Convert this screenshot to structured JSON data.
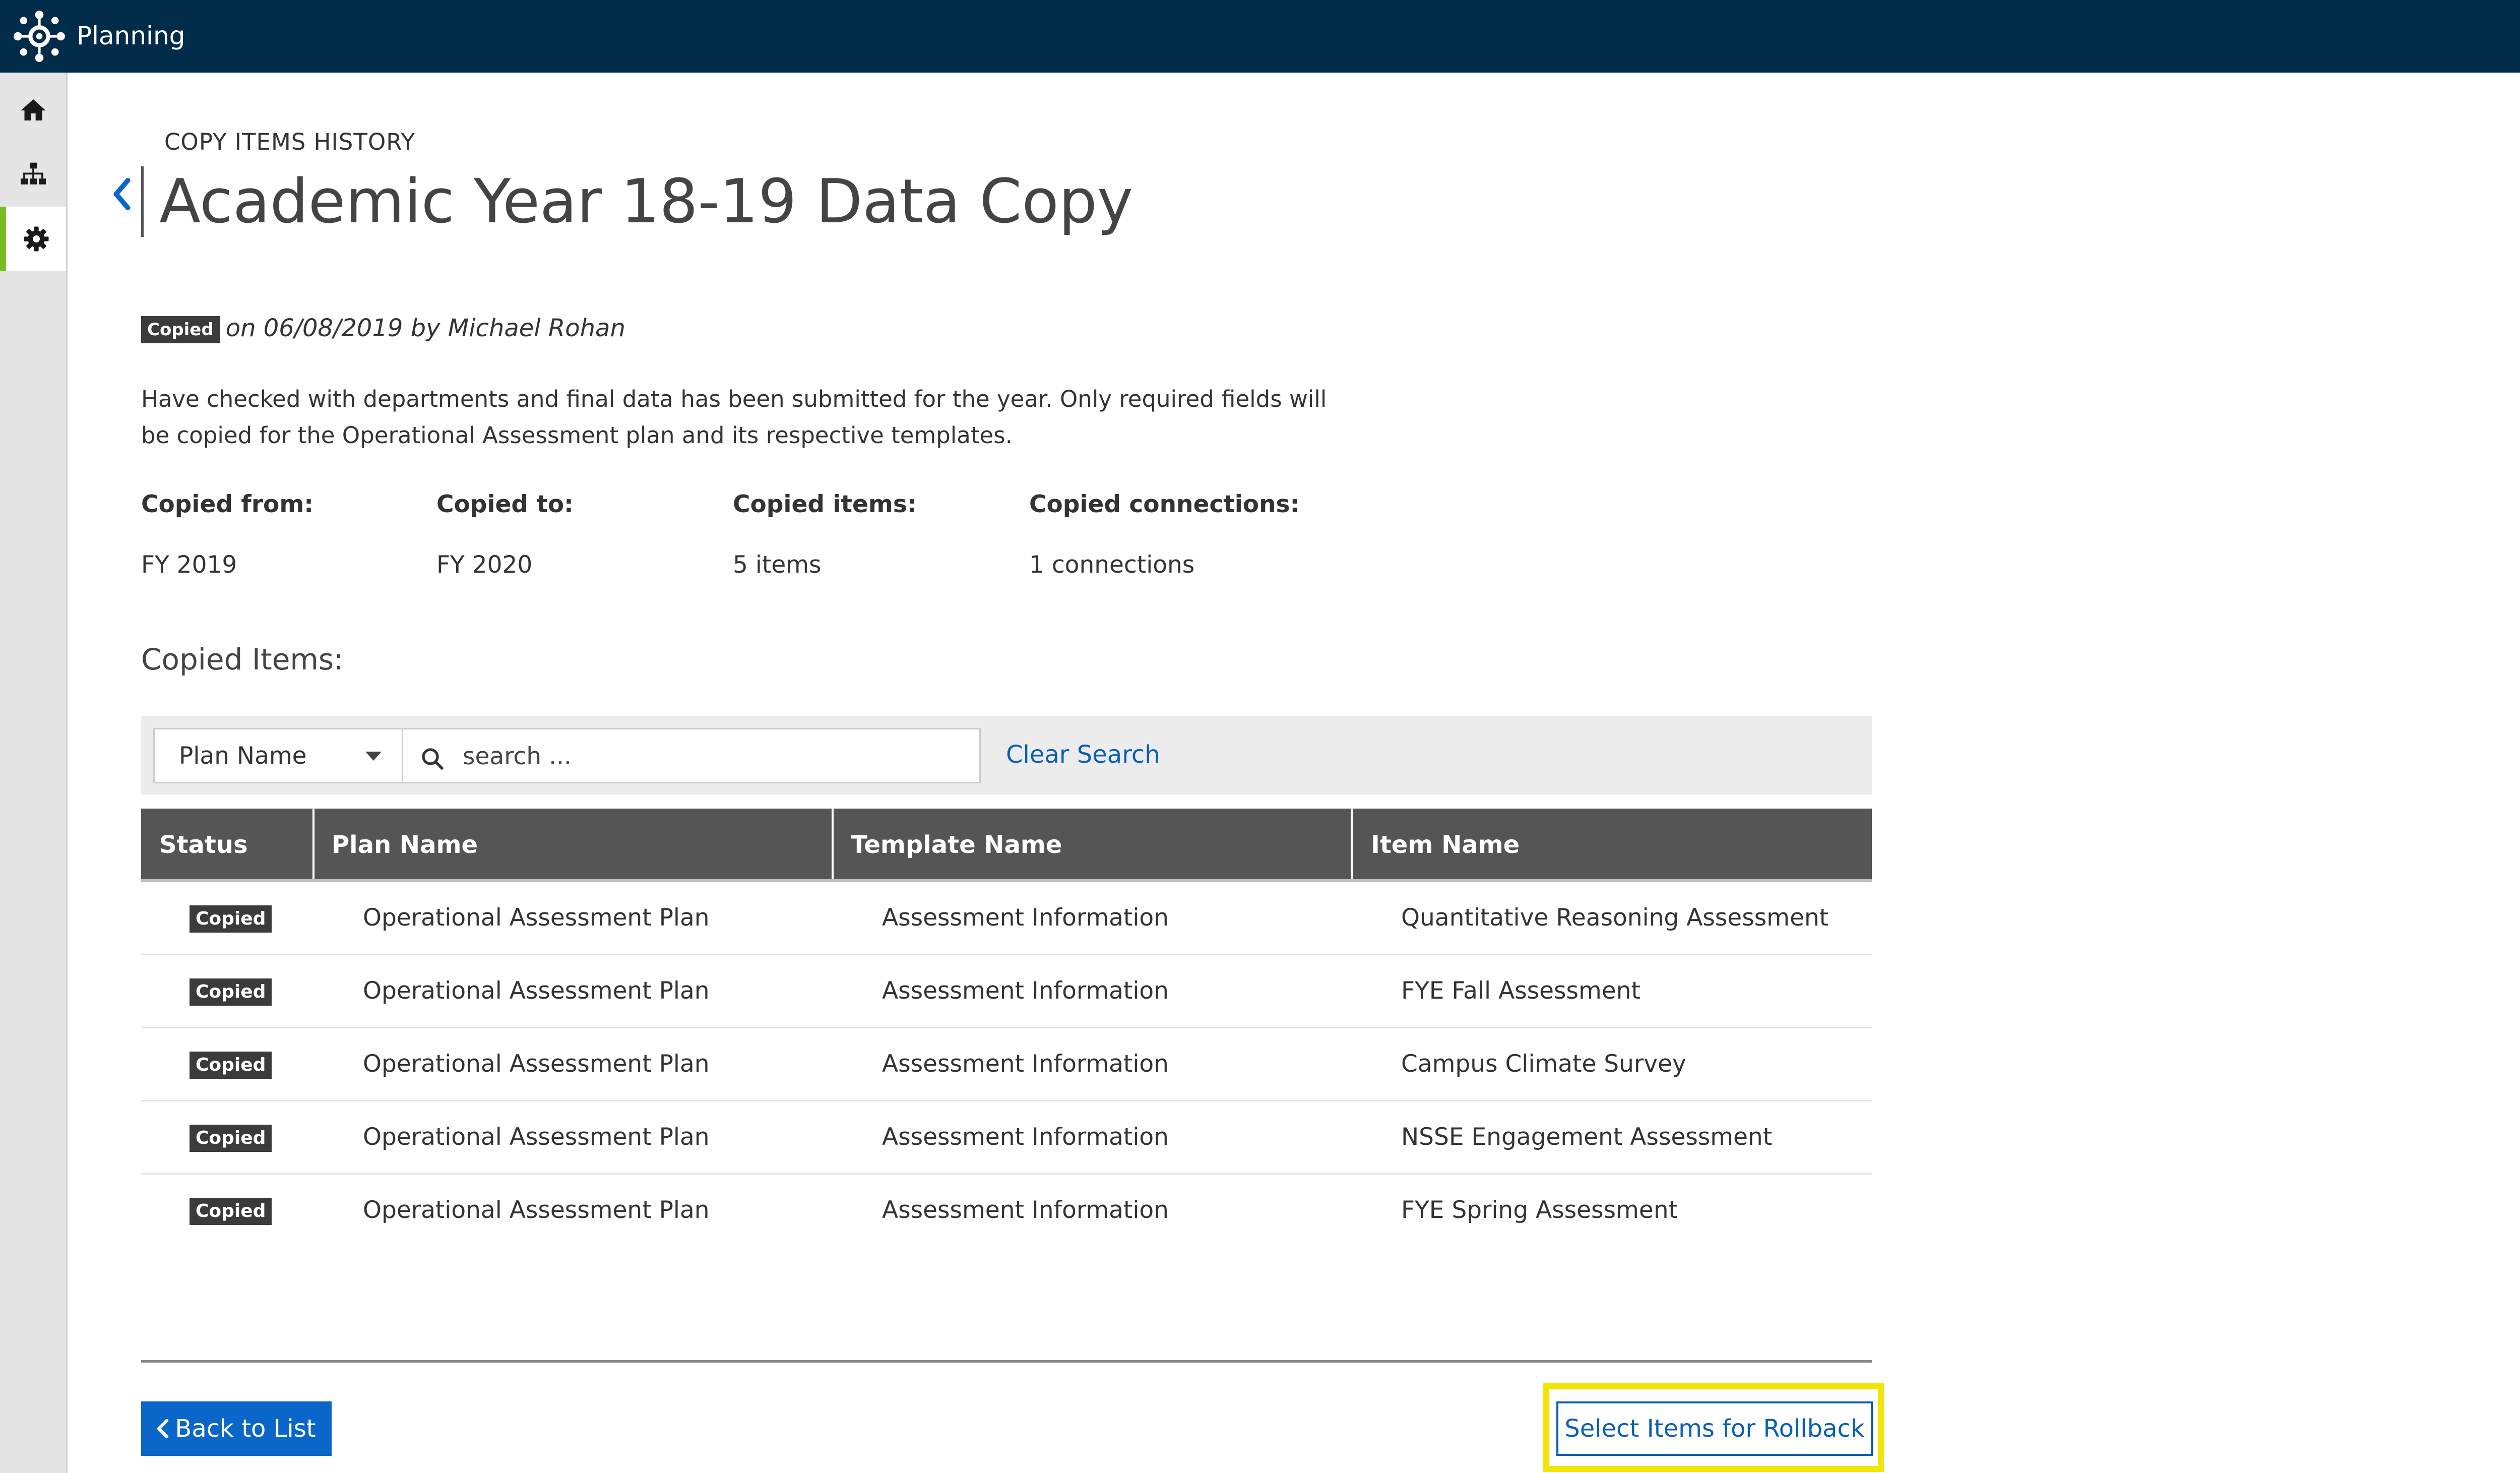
{
  "header": {
    "app_title": "Planning"
  },
  "sidebar": {
    "items": [
      {
        "icon": "home-icon",
        "active": false
      },
      {
        "icon": "hierarchy-icon",
        "active": false
      },
      {
        "icon": "gear-icon",
        "active": true
      }
    ],
    "accent_color": "#78be20"
  },
  "page": {
    "eyebrow": "COPY ITEMS HISTORY",
    "title": "Academic Year 18-19 Data Copy"
  },
  "meta": {
    "status_badge": "Copied",
    "text": "on 06/08/2019 by Michael Rohan"
  },
  "description": "Have checked with departments and final data has been submitted for the year. Only required fields will be copied for the Operational Assessment plan and its respective templates.",
  "info": {
    "copied_from_label": "Copied from:",
    "copied_from_value": "FY 2019",
    "copied_to_label": "Copied to:",
    "copied_to_value": "FY 2020",
    "copied_items_label": "Copied items:",
    "copied_items_value": "5 items",
    "copied_connections_label": "Copied connections:",
    "copied_connections_value": "1 connections"
  },
  "copied_items": {
    "section_title": "Copied Items:",
    "filter": {
      "selected": "Plan Name",
      "search_placeholder": "search ...",
      "search_value": "",
      "clear_label": "Clear Search"
    },
    "columns": [
      "Status",
      "Plan Name",
      "Template Name",
      "Item Name"
    ],
    "rows": [
      {
        "status": "Copied",
        "plan": "Operational Assessment Plan",
        "template": "Assessment Information",
        "item": "Quantitative Reasoning Assessment"
      },
      {
        "status": "Copied",
        "plan": "Operational Assessment Plan",
        "template": "Assessment Information",
        "item": "FYE Fall Assessment"
      },
      {
        "status": "Copied",
        "plan": "Operational Assessment Plan",
        "template": "Assessment Information",
        "item": "Campus Climate Survey"
      },
      {
        "status": "Copied",
        "plan": "Operational Assessment Plan",
        "template": "Assessment Information",
        "item": "NSSE Engagement Assessment"
      },
      {
        "status": "Copied",
        "plan": "Operational Assessment Plan",
        "template": "Assessment Information",
        "item": "FYE Spring Assessment"
      }
    ]
  },
  "footer": {
    "back_label": "Back to List",
    "rollback_label": "Select Items for Rollback"
  },
  "colors": {
    "topbar": "#002b49",
    "primary": "#0a66c8",
    "link": "#0a5fb4",
    "badge": "#3b3b3b",
    "table_header": "#555555",
    "highlight": "#f2e500"
  }
}
